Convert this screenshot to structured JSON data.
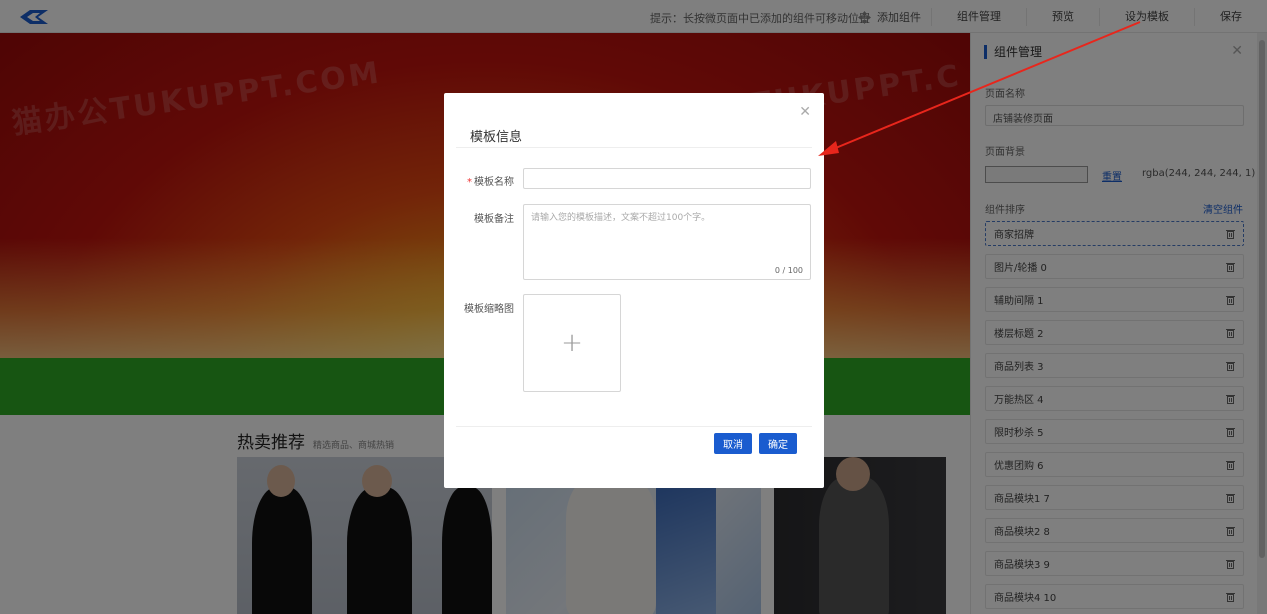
{
  "topbar": {
    "hint": "提示：长按微页面中已添加的组件可移动位置",
    "add_widget": "添加组件",
    "menu": [
      "组件管理",
      "预览",
      "设为模板",
      "保存"
    ]
  },
  "canvas": {
    "watermarks": [
      "猫办公TUKUPPT.COM",
      "TUKUPPT.C"
    ],
    "section_title": "热卖推荐",
    "section_subtitle": "精选商品、商城热销"
  },
  "panel": {
    "title": "组件管理",
    "page_name_label": "页面名称",
    "page_name_value": "店铺装修页面",
    "page_bg_label": "页面背景",
    "reset_label": "重置",
    "bg_value": "rgba(244, 244, 244, 1)",
    "sort_label": "组件排序",
    "clear_label": "清空组件",
    "components": [
      "商家招牌",
      "图片/轮播 0",
      "辅助间隔 1",
      "楼层标题 2",
      "商品列表 3",
      "万能热区 4",
      "限时秒杀 5",
      "优惠团购 6",
      "商品模块1 7",
      "商品模块2 8",
      "商品模块3 9",
      "商品模块4 10"
    ]
  },
  "modal": {
    "title": "模板信息",
    "name_label": "模板名称",
    "remark_label": "模板备注",
    "remark_placeholder": "请输入您的模板描述，文案不超过100个字。",
    "counter": "0 / 100",
    "thumb_label": "模板缩略图",
    "cancel": "取消",
    "confirm": "确定"
  },
  "colors": {
    "accent": "#1a5ccf",
    "arrow": "#e8261c",
    "banner_green": "#2faa25"
  }
}
